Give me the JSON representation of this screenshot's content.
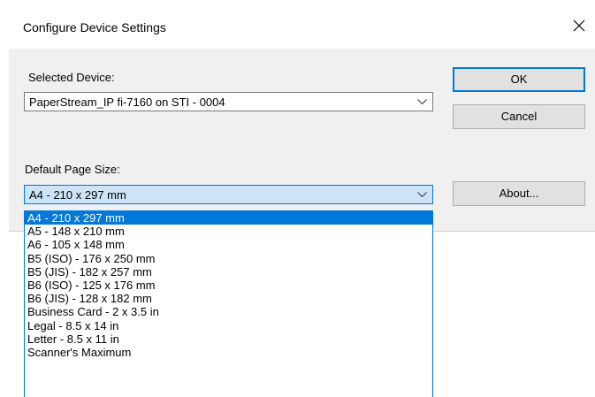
{
  "window": {
    "title": "Configure Device Settings"
  },
  "selected_device": {
    "label": "Selected Device:",
    "value": "PaperStream_IP fi-7160 on STI - 0004"
  },
  "page_size": {
    "label": "Default Page Size:",
    "value": "A4 - 210 x 297 mm",
    "options": [
      "A4 - 210 x 297 mm",
      "A5 - 148 x 210 mm",
      "A6 - 105 x 148 mm",
      "B5 (ISO) - 176 x 250 mm",
      "B5 (JIS) - 182 x 257 mm",
      "B6 (ISO) - 125 x 176 mm",
      "B6 (JIS) - 128 x 182 mm",
      "Business Card - 2 x 3.5 in",
      "Legal - 8.5 x 14 in",
      "Letter - 8.5 x 11 in",
      "Scanner's Maximum"
    ],
    "selected_index": 0
  },
  "buttons": {
    "ok": "OK",
    "cancel": "Cancel",
    "about": "About..."
  },
  "icons": {
    "close": "close-icon",
    "dropdown": "chevron-down-icon"
  },
  "colors": {
    "accent": "#0078d7",
    "dialog_bg": "#f0f0f0",
    "focused_combo_bg": "#cce4f7"
  }
}
